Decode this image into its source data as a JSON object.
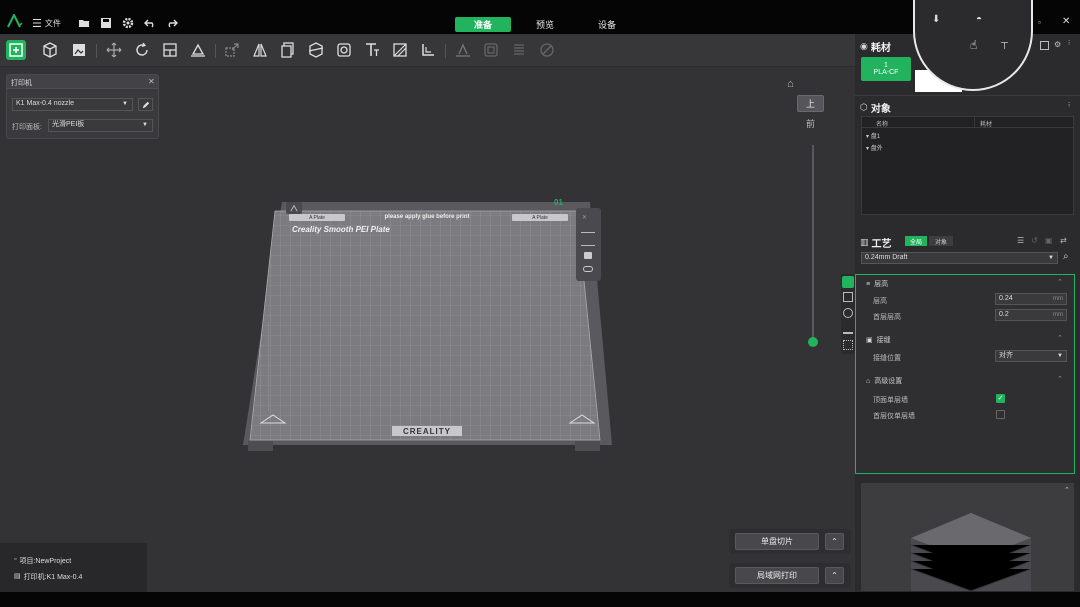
{
  "titlebar": {
    "file_menu": "文件",
    "tabs": [
      "准备",
      "预览",
      "设备"
    ],
    "active_tab": 0
  },
  "colors": {
    "accent": "#21b35d",
    "bg_dark": "#050506",
    "bg_panel": "#2b2b2e"
  },
  "printer_panel": {
    "title": "打印机",
    "printer_value": "K1 Max-0.4 nozzle",
    "plate_label": "打印面板:",
    "plate_value": "光滑PEI板"
  },
  "plate": {
    "tag_left": "A Plate",
    "tag_center": "please apply glue before print",
    "tag_right": "A Plate",
    "brand_title": "Creality Smooth PEI Plate",
    "logo_text": "CREALITY",
    "plate_index": "01"
  },
  "view_controls": {
    "top_view": "上",
    "front_view": "前"
  },
  "filament": {
    "title": "耗材",
    "slot_number": "1",
    "slot_name": "PLA-CF"
  },
  "objects": {
    "title": "对象",
    "col_name": "名称",
    "col_material": "耗材",
    "rows": [
      "盘1",
      "盘外"
    ]
  },
  "process": {
    "title": "工艺",
    "tab_global": "全局",
    "tab_object": "对象",
    "preset": "0.24mm Draft",
    "groups": {
      "quality": "层高",
      "layer_height_label": "层高",
      "layer_height_value": "0.24",
      "layer_height_unit": "mm",
      "first_layer_label": "首层层高",
      "first_layer_value": "0.2",
      "first_layer_unit": "mm",
      "seam": "接缝",
      "seam_pos_label": "接缝位置",
      "seam_pos_value": "对齐",
      "advanced": "高级设置",
      "adv_opt1_label": "顶面单层墙",
      "adv_opt1_checked": true,
      "adv_opt2_label": "首层仅单层墙",
      "adv_opt2_checked": false
    }
  },
  "actions": {
    "slice_label": "单盘切片",
    "print_label": "局域网打印"
  },
  "project_info": {
    "project": "项目:NewProject",
    "printer": "打印机:K1 Max-0.4"
  }
}
